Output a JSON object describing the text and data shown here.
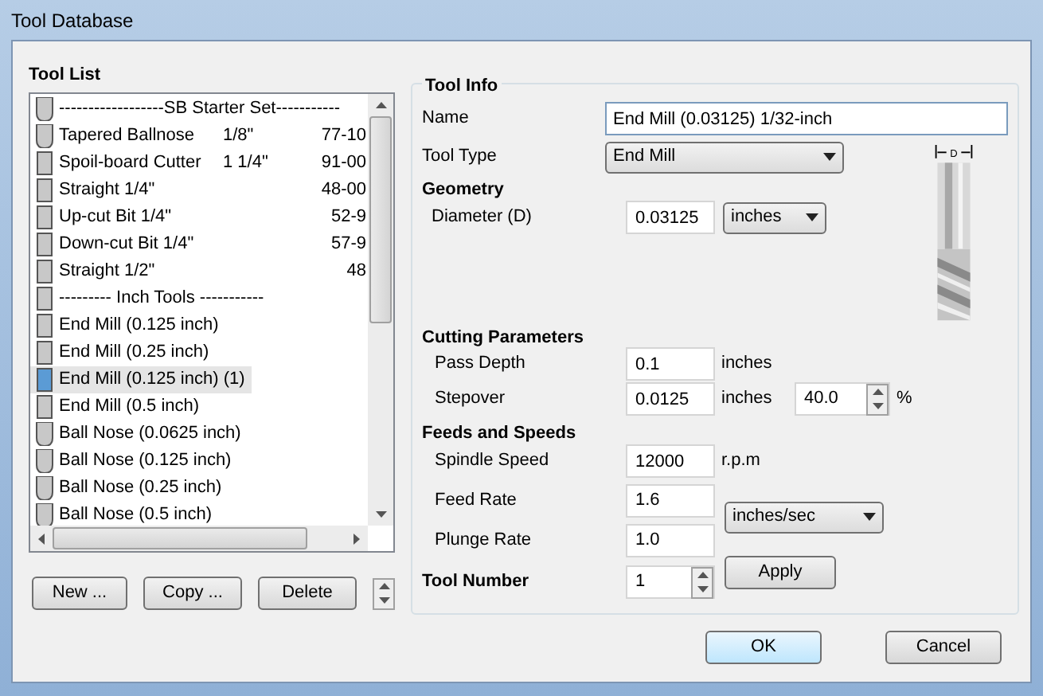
{
  "window": {
    "title": "Tool Database"
  },
  "tool_list": {
    "title": "Tool List",
    "items": [
      {
        "kind": "ballnose",
        "label": "------------------SB Starter Set-----------",
        "selected": false
      },
      {
        "kind": "ballnose",
        "label": "Tapered Ballnose",
        "size": "1/8\"",
        "code": "77-10",
        "selected": false
      },
      {
        "kind": "endmill",
        "label": "Spoil-board Cutter",
        "size": "1 1/4\"",
        "code": "91-00",
        "selected": false
      },
      {
        "kind": "endmill",
        "label": "Straight 1/4\"",
        "code": "48-00",
        "selected": false
      },
      {
        "kind": "endmill",
        "label": "Up-cut Bit 1/4\"",
        "code": "52-9",
        "selected": false
      },
      {
        "kind": "endmill",
        "label": "Down-cut Bit 1/4\"",
        "code": "57-9",
        "selected": false
      },
      {
        "kind": "endmill",
        "label": "Straight 1/2\"",
        "code": "48",
        "selected": false
      },
      {
        "kind": "endmill",
        "label": "--------- Inch Tools -----------",
        "selected": false
      },
      {
        "kind": "endmill",
        "label": "End Mill (0.125 inch)",
        "selected": false
      },
      {
        "kind": "endmill",
        "label": "End Mill (0.25 inch)",
        "selected": false
      },
      {
        "kind": "endmill",
        "label": "End Mill (0.125 inch) (1)",
        "selected": true
      },
      {
        "kind": "endmill",
        "label": "End Mill (0.5 inch)",
        "selected": false
      },
      {
        "kind": "ballnose",
        "label": "Ball Nose (0.0625 inch)",
        "selected": false
      },
      {
        "kind": "ballnose",
        "label": "Ball Nose (0.125 inch)",
        "selected": false
      },
      {
        "kind": "ballnose",
        "label": "Ball Nose (0.25 inch)",
        "selected": false
      },
      {
        "kind": "ballnose",
        "label": "Ball Nose (0.5 inch)",
        "selected": false
      }
    ],
    "buttons": [
      "New ...",
      "Copy ...",
      "Delete"
    ]
  },
  "tool_info": {
    "title": "Tool Info",
    "name": {
      "label": "Name",
      "value": "End Mill (0.03125) 1/32-inch"
    },
    "tool_type": {
      "label": "Tool Type",
      "value": "End Mill"
    },
    "geometry": {
      "title": "Geometry",
      "diameter": {
        "label": "Diameter (D)",
        "value": "0.03125",
        "unit": "inches"
      },
      "diagram_label": "D"
    },
    "cutting": {
      "title": "Cutting Parameters",
      "pass_depth": {
        "label": "Pass Depth",
        "value": "0.1",
        "unit": "inches"
      },
      "stepover": {
        "label": "Stepover",
        "value": "0.0125",
        "unit": "inches",
        "percent": "40.0",
        "percent_sign": "%"
      }
    },
    "feeds": {
      "title": "Feeds and Speeds",
      "spindle": {
        "label": "Spindle Speed",
        "value": "12000",
        "unit": "r.p.m"
      },
      "feed_rate": {
        "label": "Feed Rate",
        "value": "1.6"
      },
      "plunge_rate": {
        "label": "Plunge Rate",
        "value": "1.0"
      },
      "rate_unit": "inches/sec"
    },
    "tool_number": {
      "label": "Tool Number",
      "value": "1"
    },
    "apply": "Apply"
  },
  "buttons": [
    "OK",
    "Cancel"
  ]
}
